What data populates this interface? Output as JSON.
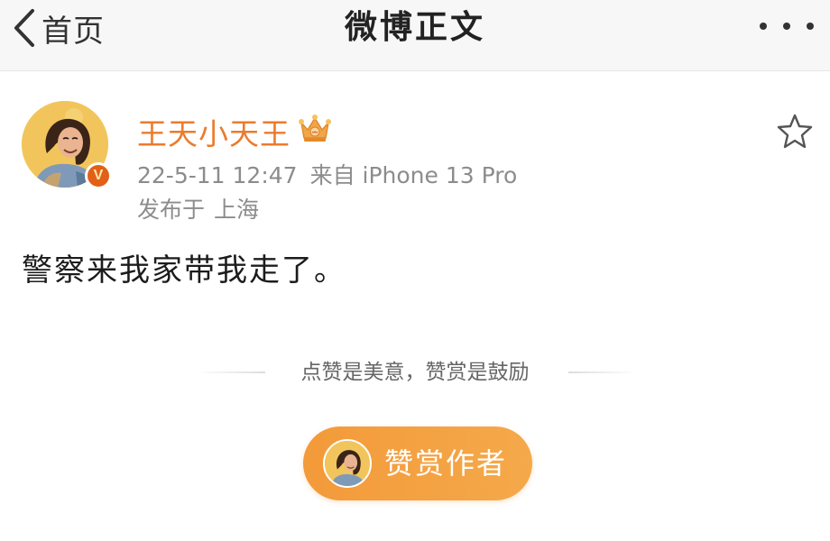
{
  "navbar": {
    "back_label": "首页",
    "title": "微博正文",
    "back_icon": "chevron-left-icon",
    "more_icon": "more-dots-icon"
  },
  "post": {
    "author": {
      "name": "王天小天王",
      "avatar_icon": "user-avatar",
      "verified_badge": "V",
      "crown_icon": "crown-icon",
      "name_color": "#eb7b2c"
    },
    "timestamp": "22-5-11 12:47",
    "source": "来自 iPhone 13 Pro",
    "location_prefix": "发布于",
    "location": "上海",
    "content": "警察来我家带我走了。",
    "favorite_icon": "star-outline-icon"
  },
  "reward": {
    "tagline": "点赞是美意，赞赏是鼓励",
    "button_label": "赞赏作者",
    "button_color": "#f39a3a"
  }
}
